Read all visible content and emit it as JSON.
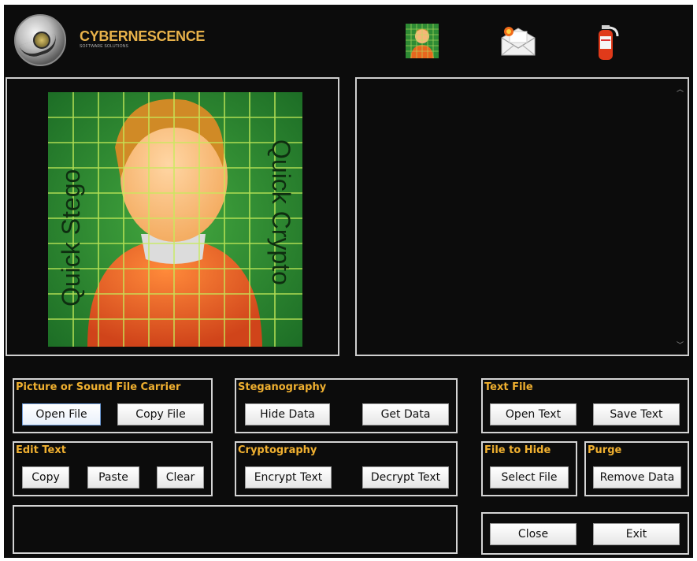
{
  "header": {
    "brand_name": "CYBERNESCENCE",
    "brand_subtitle": "SOFTWARE SOLUTIONS",
    "icons": [
      "stego-portrait-icon",
      "mail-icon",
      "fire-extinguisher-icon"
    ]
  },
  "preview": {
    "left_caption": "Quick Stego",
    "right_caption": "Quick Crypto"
  },
  "groups": {
    "carrier": {
      "title": "Picture or Sound File Carrier",
      "open_file": "Open File",
      "copy_file": "Copy File"
    },
    "stego": {
      "title": "Steganography",
      "hide_data": "Hide Data",
      "get_data": "Get Data"
    },
    "text_file": {
      "title": "Text File",
      "open_text": "Open Text",
      "save_text": "Save Text"
    },
    "edit_text": {
      "title": "Edit Text",
      "copy": "Copy",
      "paste": "Paste",
      "clear": "Clear"
    },
    "crypto": {
      "title": "Cryptography",
      "encrypt": "Encrypt Text",
      "decrypt": "Decrypt Text"
    },
    "file_to_hide": {
      "title": "File to Hide",
      "select_file": "Select File"
    },
    "purge": {
      "title": "Purge",
      "remove_data": "Remove Data"
    },
    "window": {
      "close": "Close",
      "exit": "Exit"
    }
  },
  "colors": {
    "background": "#0c0c0c",
    "accent": "#f0b030",
    "border": "#d4d4d4"
  }
}
